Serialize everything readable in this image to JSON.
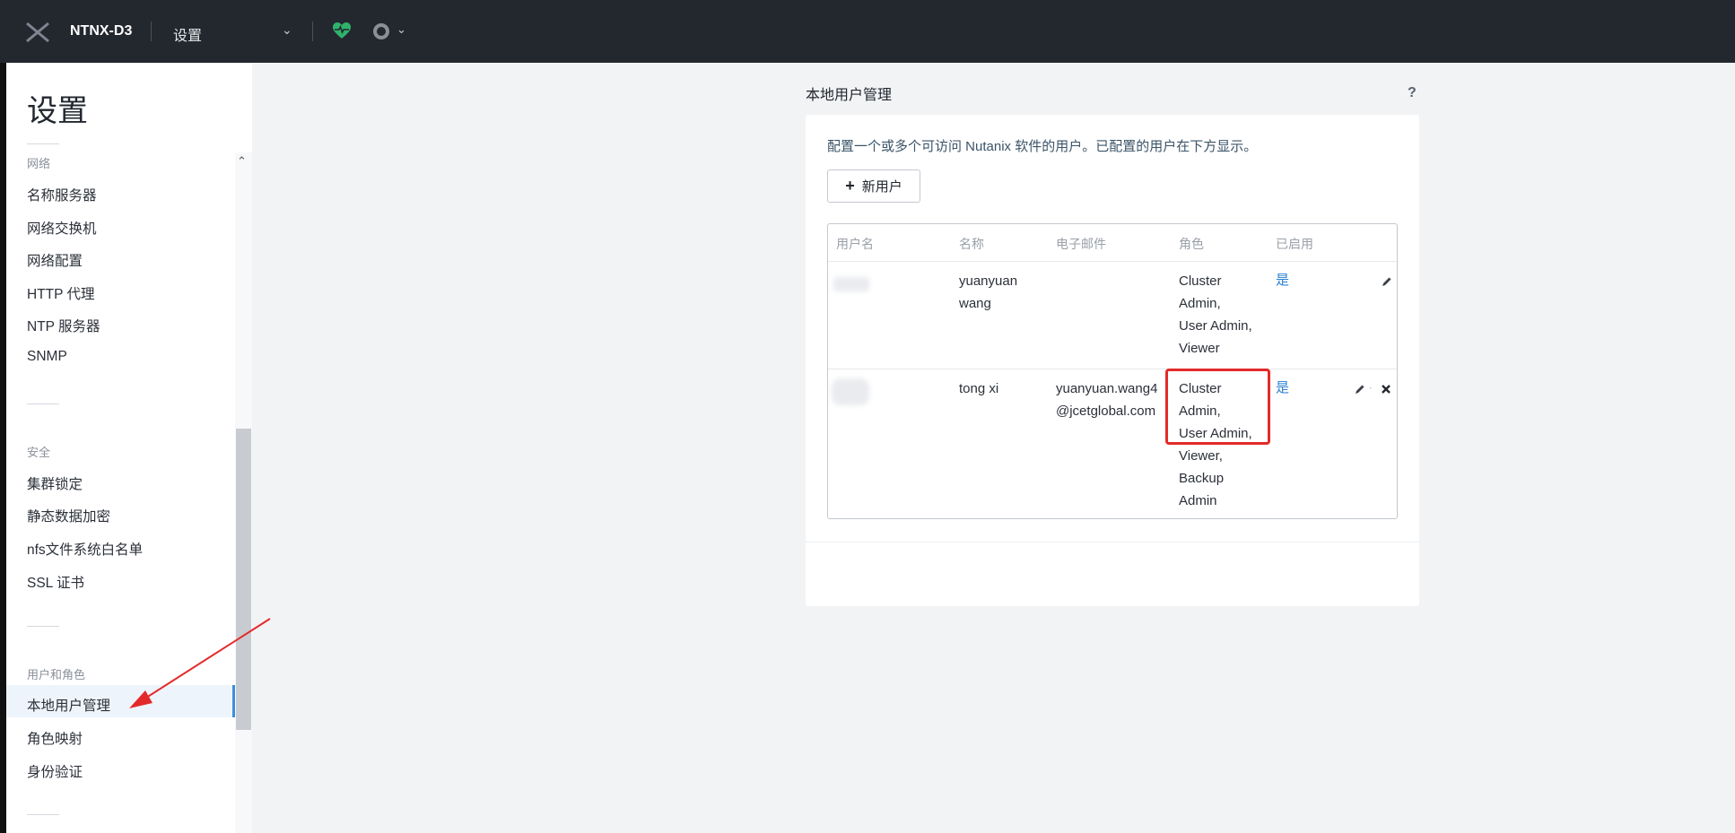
{
  "header": {
    "cluster_name": "NTNX-D3",
    "page_label": "设置",
    "nav_dropdown_icon": "chevron-down-icon",
    "health_icon": "heart-pulse-icon",
    "alerts_icon": "alert-circle-icon",
    "health_color": "#2fb36b"
  },
  "sidebar": {
    "title": "设置",
    "groups": [
      {
        "label": "网络",
        "items": [
          "名称服务器",
          "网络交换机",
          "网络配置",
          "HTTP 代理",
          "NTP 服务器",
          "SNMP"
        ]
      },
      {
        "label": "安全",
        "items": [
          "集群锁定",
          "静态数据加密",
          "nfs文件系统白名单",
          "SSL 证书"
        ]
      },
      {
        "label": "用户和角色",
        "items": [
          "本地用户管理",
          "角色映射",
          "身份验证"
        ]
      }
    ],
    "active_item": "本地用户管理"
  },
  "main": {
    "section_title": "本地用户管理",
    "help_label": "?",
    "description": "配置一个或多个可访问 Nutanix 软件的用户。已配置的用户在下方显示。",
    "add_user_plus": "+",
    "add_user_label": "新用户",
    "table": {
      "headers": [
        "用户名",
        "名称",
        "电子邮件",
        "角色",
        "已启用"
      ],
      "rows": [
        {
          "name_lines": [
            "yuanyuan",
            "wang"
          ],
          "email_lines": [],
          "role_lines": [
            "Cluster",
            "Admin,",
            "User Admin,",
            "Viewer"
          ],
          "enabled": "是"
        },
        {
          "name_lines": [
            "tong xi"
          ],
          "email_lines": [
            "yuanyuan.wang4",
            "@jcetglobal.com"
          ],
          "role_lines": [
            "Cluster",
            "Admin,",
            "User Admin,",
            "Viewer,",
            "Backup",
            "Admin"
          ],
          "enabled": "是"
        }
      ]
    }
  },
  "colors": {
    "accent": "#3b8fdc",
    "annotation_red": "#e32a2a",
    "topbar": "#23282f"
  }
}
